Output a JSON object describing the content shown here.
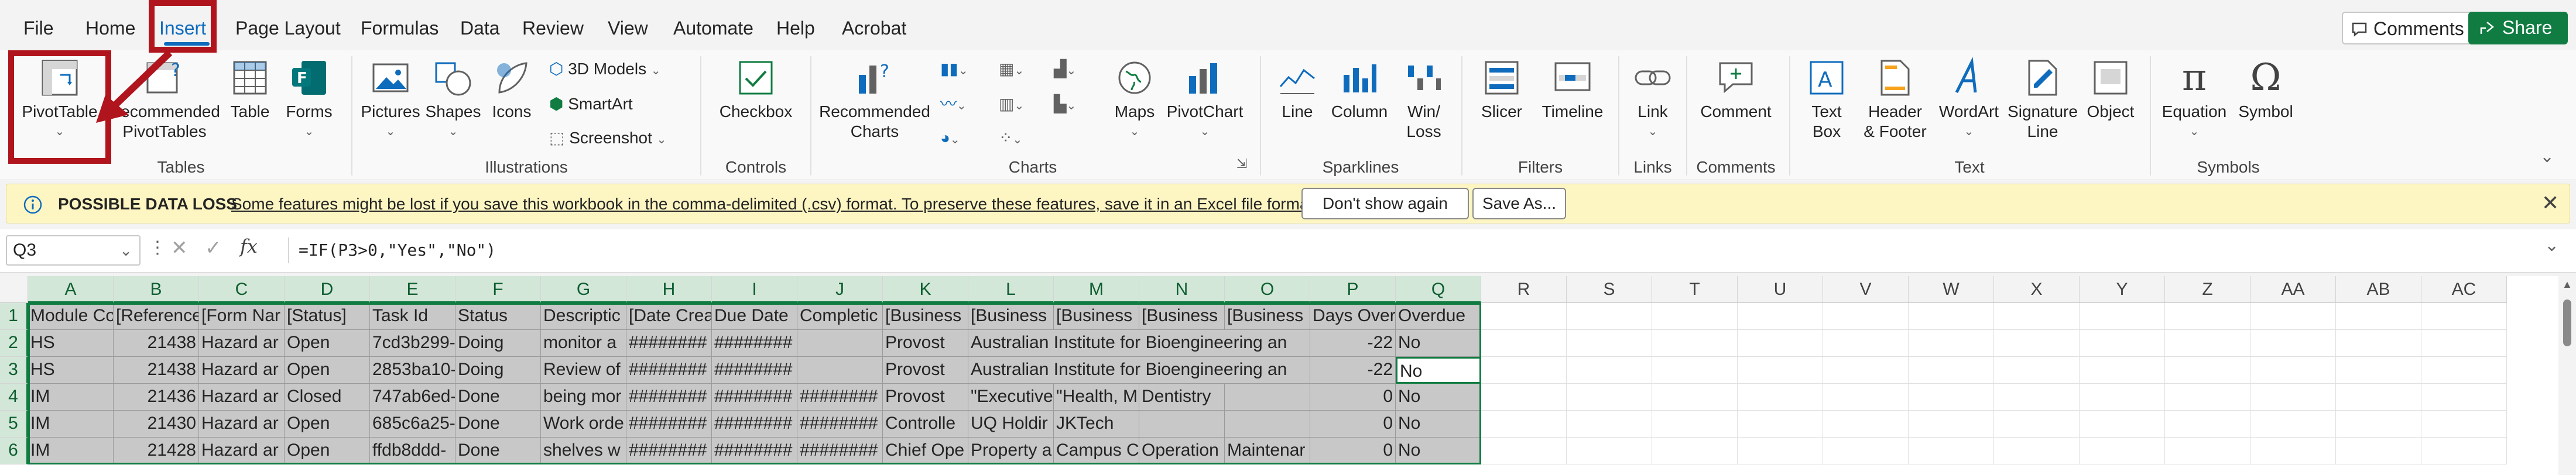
{
  "menu": {
    "tabs": [
      "File",
      "Home",
      "Insert",
      "Page Layout",
      "Formulas",
      "Data",
      "Review",
      "View",
      "Automate",
      "Help",
      "Acrobat"
    ],
    "comments_label": "Comments",
    "share_label": "Share"
  },
  "ribbon": {
    "tables": {
      "pivot_table": "PivotTable",
      "recommended_pivot_1": "Recommended",
      "recommended_pivot_2": "PivotTables",
      "table": "Table",
      "forms": "Forms",
      "group": "Tables"
    },
    "illustrations": {
      "pictures": "Pictures",
      "shapes": "Shapes",
      "icons": "Icons",
      "models_3d": "3D Models",
      "smartart": "SmartArt",
      "screenshot": "Screenshot",
      "group": "Illustrations"
    },
    "controls": {
      "checkbox": "Checkbox",
      "group": "Controls"
    },
    "charts": {
      "recommended_1": "Recommended",
      "recommended_2": "Charts",
      "maps": "Maps",
      "pivot_chart": "PivotChart",
      "group": "Charts"
    },
    "sparklines": {
      "line": "Line",
      "column": "Column",
      "winloss_1": "Win/",
      "winloss_2": "Loss",
      "group": "Sparklines"
    },
    "filters": {
      "slicer": "Slicer",
      "timeline": "Timeline",
      "group": "Filters"
    },
    "links": {
      "link": "Link",
      "group": "Links"
    },
    "comments": {
      "comment": "Comment",
      "group": "Comments"
    },
    "text": {
      "textbox_1": "Text",
      "textbox_2": "Box",
      "header_1": "Header",
      "header_2": "& Footer",
      "wordart": "WordArt",
      "signature_1": "Signature",
      "signature_2": "Line",
      "object": "Object",
      "group": "Text"
    },
    "symbols": {
      "equation": "Equation",
      "symbol": "Symbol",
      "group": "Symbols"
    }
  },
  "notification": {
    "title": "POSSIBLE DATA LOSS",
    "message": "Some features might be lost if you save this workbook in the comma-delimited (.csv) format. To preserve these features, save it in an Excel file format.",
    "dont_show": "Don't show again",
    "save_as": "Save As..."
  },
  "formula_bar": {
    "name_box": "Q3",
    "fx": "fx",
    "formula": "=IF(P3>0,\"Yes\",\"No\")"
  },
  "grid": {
    "columns": [
      "A",
      "B",
      "C",
      "D",
      "E",
      "F",
      "G",
      "H",
      "I",
      "J",
      "K",
      "L",
      "M",
      "N",
      "O",
      "P",
      "Q",
      "R",
      "S",
      "T",
      "U",
      "V",
      "W",
      "X",
      "Y",
      "Z",
      "AA",
      "AB",
      "AC"
    ],
    "row_numbers": [
      "1",
      "2",
      "3",
      "4",
      "5",
      "6"
    ],
    "rows": [
      [
        "Module Co",
        "[Reference",
        "[Form Nar",
        "[Status]",
        "Task Id",
        "Status",
        "Descriptic",
        "[Date Crea",
        "Due Date",
        "Completic",
        "[Business",
        "[Business",
        "[Business",
        "[Business",
        "[Business",
        "Days Over",
        "Overdue"
      ],
      [
        "HS",
        "21438",
        "Hazard ar",
        "Open",
        "7cd3b299-",
        "Doing",
        "monitor a",
        "########",
        "########",
        "",
        "Provost",
        "Australian Institute for Bioengineering an",
        "",
        "",
        "",
        "-22",
        "No"
      ],
      [
        "HS",
        "21438",
        "Hazard ar",
        "Open",
        "2853ba10-",
        "Doing",
        "Review of",
        "########",
        "########",
        "",
        "Provost",
        "Australian Institute for Bioengineering an",
        "",
        "",
        "",
        "-22",
        "No"
      ],
      [
        "IM",
        "21436",
        "Hazard ar",
        "Closed",
        "747ab6ed-",
        "Done",
        "being mor",
        "########",
        "########",
        "########",
        "Provost",
        "\"Executive",
        "\"Health, M",
        "Dentistry",
        "",
        "0",
        "No"
      ],
      [
        "IM",
        "21430",
        "Hazard ar",
        "Open",
        "685c6a25-",
        "Done",
        "Work orde",
        "########",
        "########",
        "########",
        "Controlle",
        "UQ Holdir",
        "JKTech",
        "",
        "",
        "0",
        "No"
      ],
      [
        "IM",
        "21428",
        "Hazard ar",
        "Open",
        "ffdb8ddd-",
        "Done",
        "shelves w",
        "########",
        "########",
        "########",
        "Chief Ope",
        "Property a",
        "Campus C",
        "Operation",
        "Maintenar",
        "0",
        "No"
      ]
    ]
  }
}
